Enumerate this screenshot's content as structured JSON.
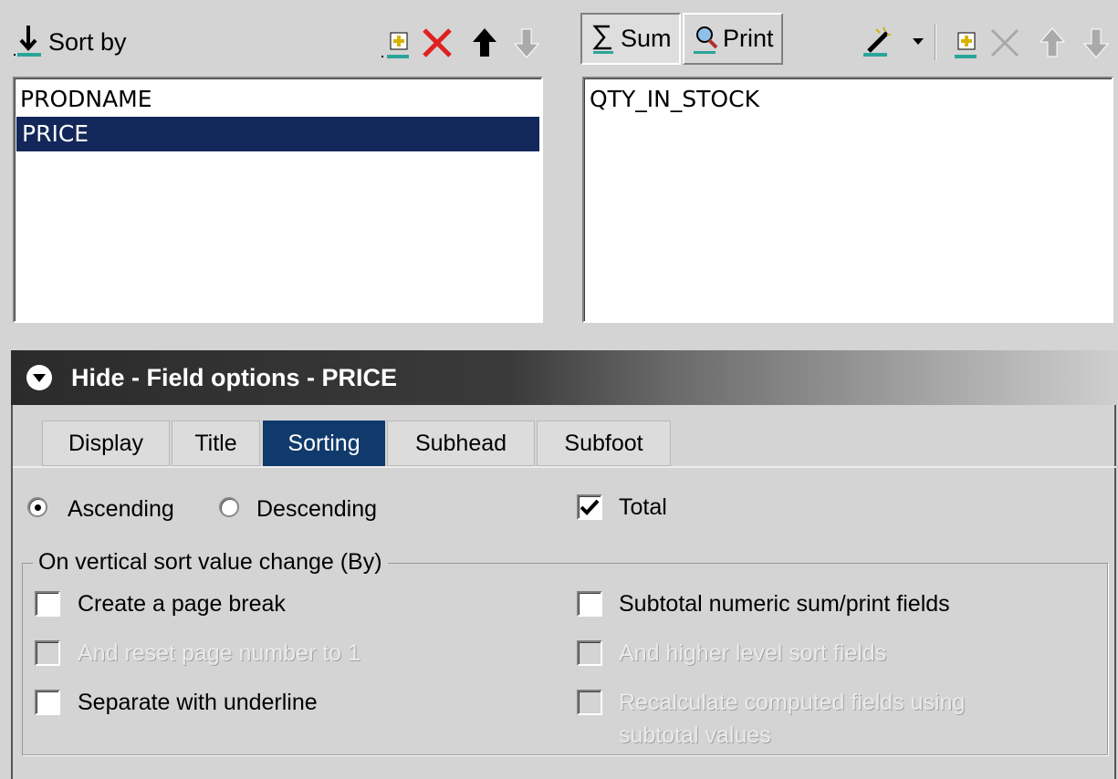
{
  "sort_toolbar": {
    "label": "Sort by"
  },
  "sort_list": {
    "items": [
      "PRODNAME",
      "PRICE"
    ],
    "selected_index": 1
  },
  "sum_toolbar": {
    "sum_label": "Sum",
    "print_label": "Print"
  },
  "sum_list": {
    "items": [
      "QTY_IN_STOCK"
    ]
  },
  "options_header": {
    "title": "Hide - Field options - PRICE"
  },
  "tabs": [
    "Display",
    "Title",
    "Sorting",
    "Subhead",
    "Subfoot"
  ],
  "active_tab": "Sorting",
  "sort_order": {
    "ascending": "Ascending",
    "descending": "Descending",
    "selected": "Ascending"
  },
  "total": {
    "label": "Total",
    "checked": true
  },
  "group": {
    "legend": "On vertical sort value change (By)",
    "page_break": "Create a page break",
    "reset_page": "And reset page number to 1",
    "underline": "Separate with underline",
    "subtotal": "Subtotal numeric sum/print fields",
    "higher_level": "And higher level sort fields",
    "recalculate_line1": "Recalculate computed fields using",
    "recalculate_line2": "subtotal values"
  },
  "colors": {
    "selection": "#13275a",
    "active_tab": "#0f3a6b",
    "delete_red": "#e02020"
  }
}
